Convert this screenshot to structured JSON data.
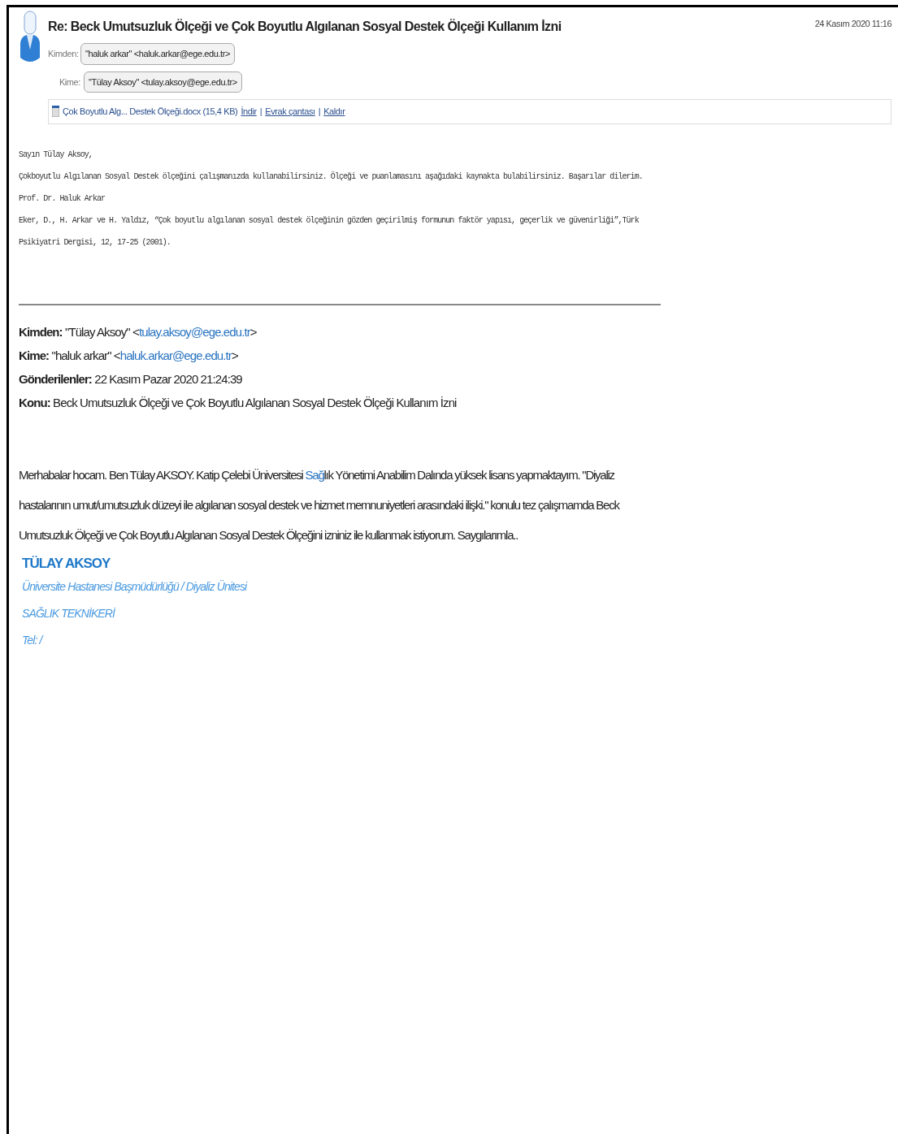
{
  "header": {
    "subject": "Re: Beck Umutsuzluk Ölçeği ve Çok Boyutlu Algılanan Sosyal Destek Ölçeği Kullanım İzni",
    "date": "24 Kasım 2020 11:16",
    "fields": [
      {
        "label": "Kimden:",
        "value": "\"haluk arkar\" <haluk.arkar@ege.edu.tr>"
      },
      {
        "label": "Kime:",
        "value": "\"Tülay Aksoy\" <tulay.aksoy@ege.edu.tr>"
      }
    ],
    "attachment": {
      "name": "Çok Boyutlu Alg... Destek Ölçeği.docx (15,4 KB)",
      "actions": [
        "İndir",
        "Evrak çantası",
        "Kaldır"
      ],
      "separators": [
        "|",
        "|"
      ]
    }
  },
  "reply_lines": [
    "Sayın Tülay Aksoy,",
    "Çokboyutlu Algılanan Sosyal Destek ölçeğini çalışmanızda kullanabilirsiniz. Ölçeği ve puanlamasını aşağıdaki kaynakta bulabilirsiniz. Başarılar dilerim.",
    "Prof. Dr. Haluk Arkar",
    "Eker, D., H. Arkar ve H. Yaldız, “Çok boyutlu algılanan sosyal destek ölçeğinin gözden geçirilmiş formunun faktör yapısı, geçerlik ve güvenirliği”,Türk Psikiyatri Dergisi, 12, 17-25 (2001)."
  ],
  "quoted_header": [
    {
      "label": "Kimden:",
      "name": "\"Tülay Aksoy\" <",
      "email": "tulay.aksoy@ege.edu.tr",
      "tail": ">"
    },
    {
      "label": "Kime:",
      "name": "\"haluk arkar\" <",
      "email": "haluk.arkar@ege.edu.tr",
      "tail": ">"
    },
    {
      "label": "Gönderilenler:",
      "name": "22 Kasım Pazar 2020 21:24:39"
    },
    {
      "label": "Konu:",
      "name": "Beck Umutsuzluk Ölçeği ve Çok Boyutlu Algılanan Sosyal Destek Ölçeği Kullanım İzni"
    }
  ],
  "message_parts": [
    {
      "text": "Merhabalar hocam. Ben Tülay AKSOY. Katip Çelebi Üniversitesi ",
      "kind": "text"
    },
    {
      "text": "Sağ",
      "kind": "link"
    },
    {
      "text": "lık Yönetimi Anabilim Dalında yüksek lisans yapmaktayım.  \"Diyaliz hastalarının umut/umutsuzluk düzeyi ile algılanan sosyal destek ve hizmet memnuniyetleri arasındaki ilişki.\" konulu tez çalışmamda Beck Umutsuzluk Ölçeği ve Çok Boyutlu Algılanan Sosyal Destek Ölçeğini  izniniz ile kullanmak istiyorum. Saygılarımla..",
      "kind": "text"
    }
  ],
  "signature": {
    "name": "TÜLAY AKSOY",
    "lines": [
      "Üniversite Hastanesi Başmüdürlüğü / Diyaliz Ünitesi",
      "SAĞLIK TEKNİKERİ",
      "Tel: /"
    ]
  }
}
